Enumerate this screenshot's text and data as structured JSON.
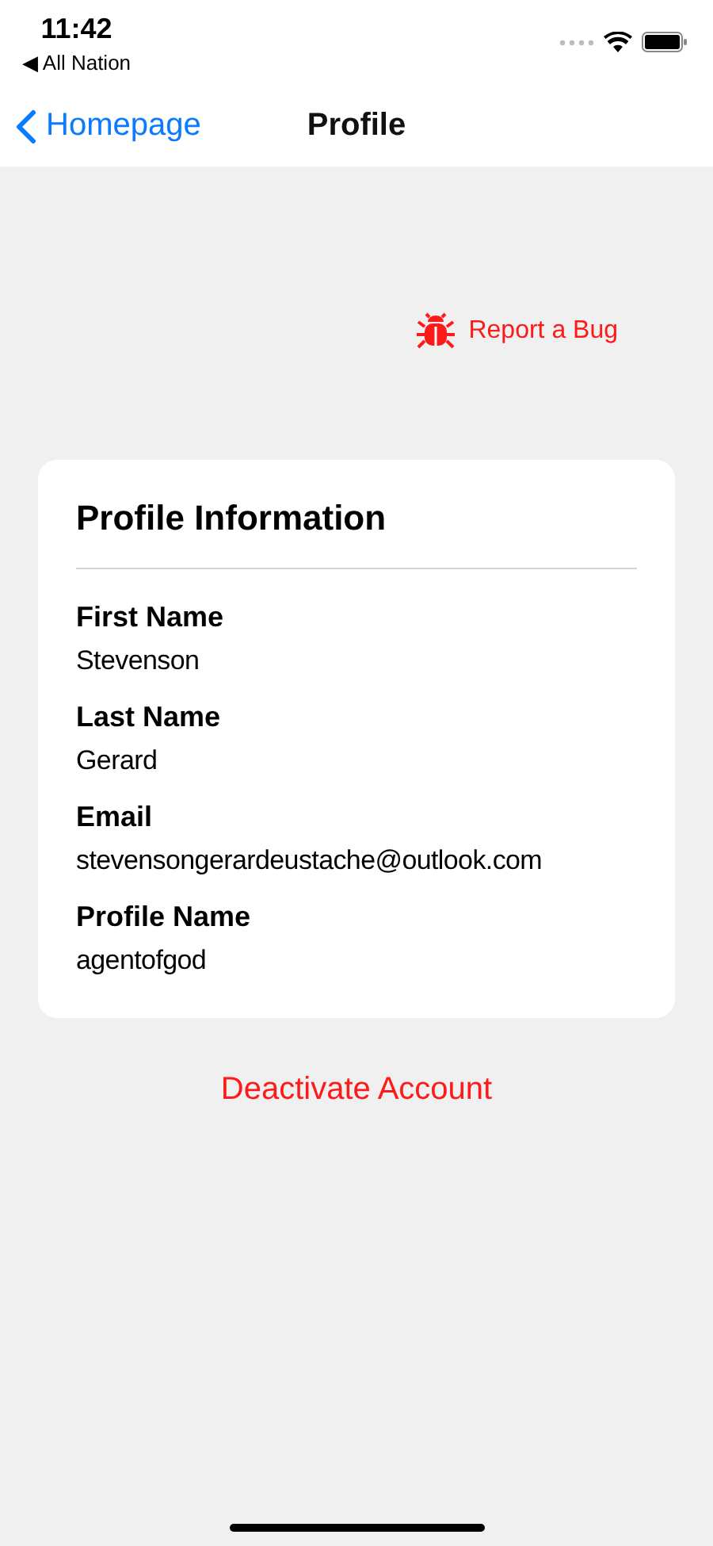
{
  "status_bar": {
    "time": "11:42",
    "back_app": "◀ All Nation"
  },
  "nav": {
    "back": "Homepage",
    "title": "Profile"
  },
  "report_bug": "Report a Bug",
  "card": {
    "title": "Profile Information",
    "fields": [
      {
        "label": "First Name",
        "value": "Stevenson"
      },
      {
        "label": "Last Name",
        "value": "Gerard"
      },
      {
        "label": "Email",
        "value": "stevensongerardeustache@outlook.com"
      },
      {
        "label": "Profile Name",
        "value": "agentofgod"
      }
    ]
  },
  "deactivate": "Deactivate Account"
}
